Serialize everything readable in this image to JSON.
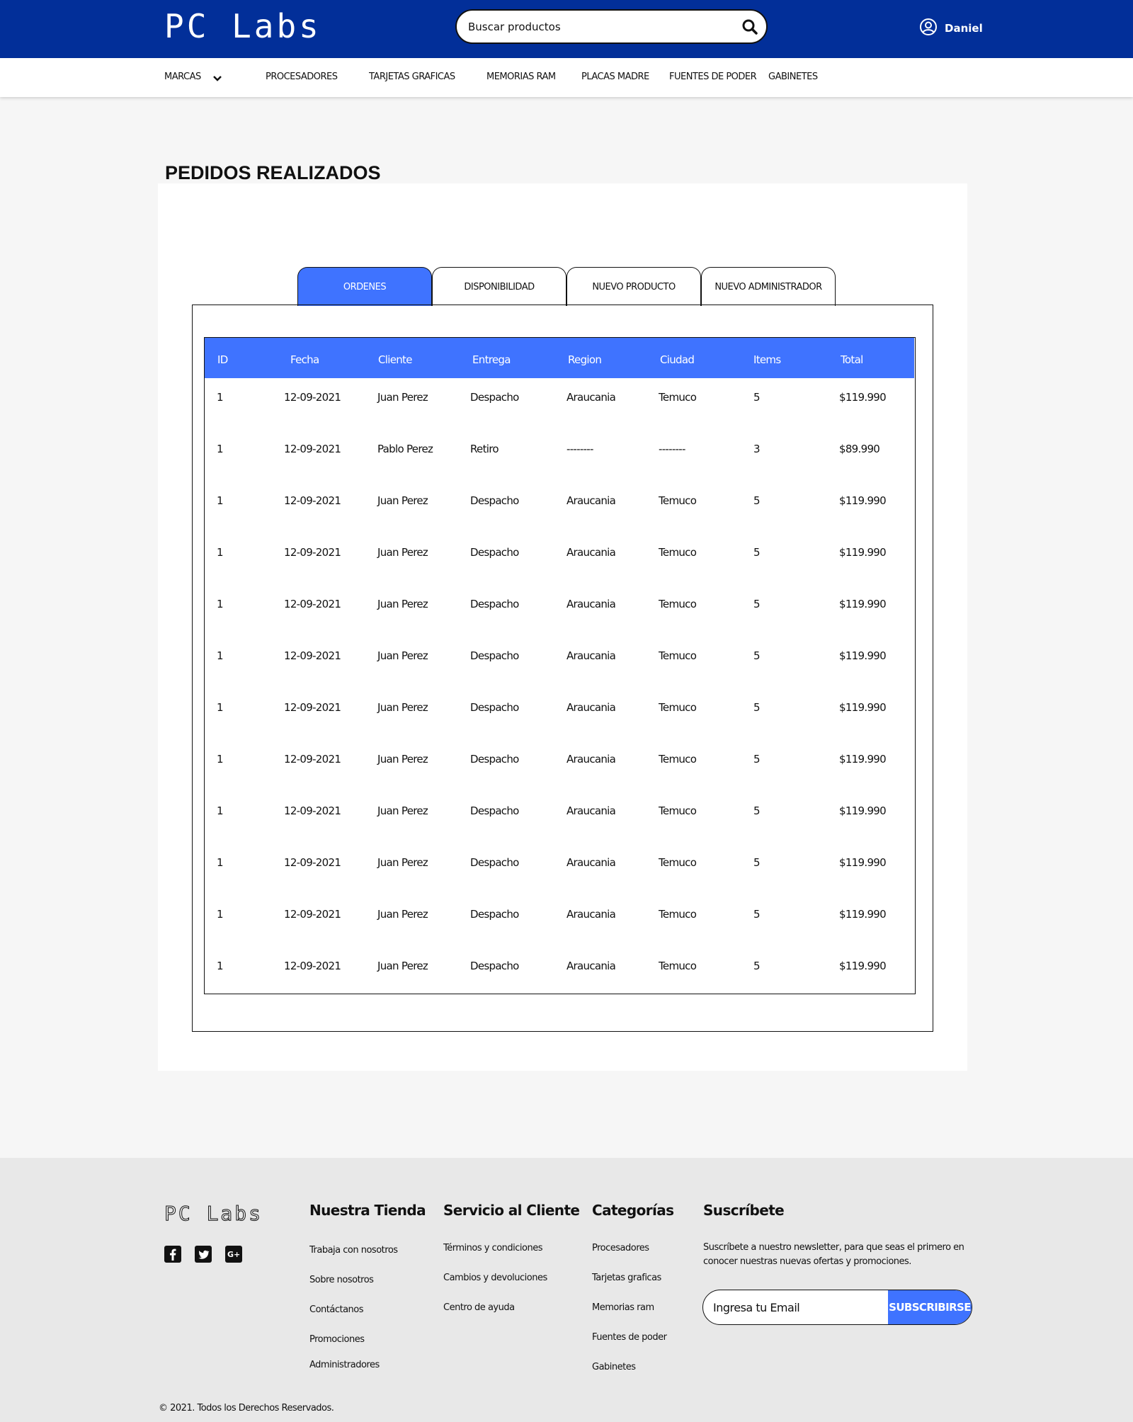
{
  "header": {
    "logo": "PC Labs",
    "search_placeholder": "Buscar productos",
    "user_name": "Daniel",
    "brand_color": "#022f99"
  },
  "nav": {
    "items": [
      "MARCAS",
      "PROCESADORES",
      "TARJETAS GRAFICAS",
      "MEMORIAS RAM",
      "PLACAS MADRE",
      "FUENTES DE PODER",
      "GABINETES"
    ]
  },
  "main": {
    "title": "PEDIDOS REALIZADOS",
    "tabs": [
      "ORDENES",
      "DISPONIBILIDAD",
      "NUEVO PRODUCTO",
      "NUEVO ADMINISTRADOR"
    ],
    "active_tab": "ORDENES",
    "accent_color": "#3f73ff",
    "table": {
      "columns": [
        "ID",
        "Fecha",
        "Cliente",
        "Entrega",
        "Region",
        "Ciudad",
        "Items",
        "Total"
      ],
      "rows": [
        [
          "1",
          "12-09-2021",
          "Juan Perez",
          "Despacho",
          "Araucania",
          "Temuco",
          "5",
          "$119.990"
        ],
        [
          "1",
          "12-09-2021",
          "Pablo Perez",
          "Retiro",
          "--------",
          "--------",
          "3",
          "$89.990"
        ],
        [
          "1",
          "12-09-2021",
          "Juan Perez",
          "Despacho",
          "Araucania",
          "Temuco",
          "5",
          "$119.990"
        ],
        [
          "1",
          "12-09-2021",
          "Juan Perez",
          "Despacho",
          "Araucania",
          "Temuco",
          "5",
          "$119.990"
        ],
        [
          "1",
          "12-09-2021",
          "Juan Perez",
          "Despacho",
          "Araucania",
          "Temuco",
          "5",
          "$119.990"
        ],
        [
          "1",
          "12-09-2021",
          "Juan Perez",
          "Despacho",
          "Araucania",
          "Temuco",
          "5",
          "$119.990"
        ],
        [
          "1",
          "12-09-2021",
          "Juan Perez",
          "Despacho",
          "Araucania",
          "Temuco",
          "5",
          "$119.990"
        ],
        [
          "1",
          "12-09-2021",
          "Juan Perez",
          "Despacho",
          "Araucania",
          "Temuco",
          "5",
          "$119.990"
        ],
        [
          "1",
          "12-09-2021",
          "Juan Perez",
          "Despacho",
          "Araucania",
          "Temuco",
          "5",
          "$119.990"
        ],
        [
          "1",
          "12-09-2021",
          "Juan Perez",
          "Despacho",
          "Araucania",
          "Temuco",
          "5",
          "$119.990"
        ],
        [
          "1",
          "12-09-2021",
          "Juan Perez",
          "Despacho",
          "Araucania",
          "Temuco",
          "5",
          "$119.990"
        ],
        [
          "1",
          "12-09-2021",
          "Juan Perez",
          "Despacho",
          "Araucania",
          "Temuco",
          "5",
          "$119.990"
        ]
      ]
    }
  },
  "footer": {
    "logo": "PC Labs",
    "social_icons": [
      "facebook-icon",
      "twitter-icon",
      "google-plus-icon"
    ],
    "columns": [
      {
        "heading": "Nuestra Tienda",
        "links": [
          "Trabaja con nosotros",
          "Sobre nosotros",
          "Contáctanos",
          "Promociones",
          "Administradores"
        ]
      },
      {
        "heading": "Servicio al Cliente",
        "links": [
          "Términos y condiciones",
          "Cambios y devoluciones",
          "Centro de ayuda"
        ]
      },
      {
        "heading": "Categorías",
        "links": [
          "Procesadores",
          "Tarjetas graficas",
          "Memorias ram",
          "Fuentes de poder",
          "Gabinetes"
        ]
      }
    ],
    "newsletter": {
      "heading": "Suscríbete",
      "text": "Suscríbete a nuestro newsletter, para que seas el primero en conocer nuestras nuevas ofertas y promociones.",
      "email_placeholder": "Ingresa tu Email",
      "button_label": "SUBSCRIBIRSE"
    },
    "copyright": "© 2021. Todos los Derechos Reservados."
  }
}
